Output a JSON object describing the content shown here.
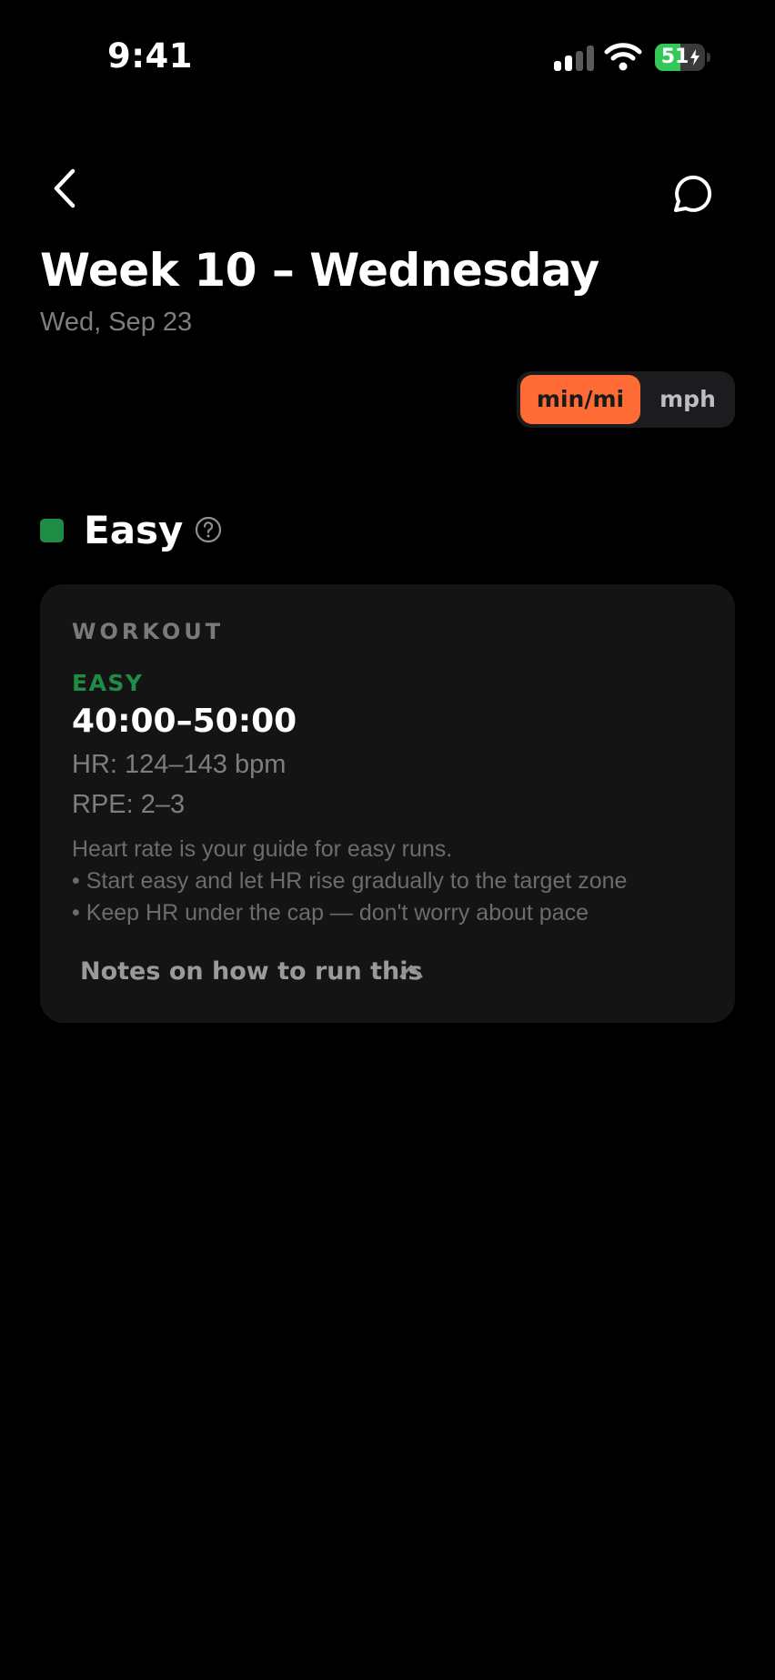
{
  "status_bar": {
    "time": "9:41",
    "battery_level": "51",
    "battery_fraction": 0.51,
    "icons": [
      "cellular-signal-icon",
      "wifi-icon",
      "battery-charging-icon"
    ]
  },
  "header": {
    "back_icon": "chevron-left-icon",
    "chat_icon": "chat-bubble-icon",
    "title": "Week 10 – Wednesday",
    "date": "Wed, Sep 23"
  },
  "unit_toggle": {
    "options": [
      {
        "label": "min/mi",
        "selected": true
      },
      {
        "label": "mph",
        "selected": false
      }
    ]
  },
  "section": {
    "label": "Easy",
    "help_icon": "question-circle-icon"
  },
  "workout": {
    "section_label": "WORKOUT",
    "type": "EASY",
    "duration": "40:00–50:00",
    "hr": "HR: 124–143 bpm",
    "rpe": "RPE: 2–3",
    "notes": [
      "Heart rate is your guide for easy runs.",
      "• Start easy and let HR rise gradually to the target zone",
      "• Keep HR under the cap — don't worry about pace"
    ],
    "notes_toggle_label": "Notes on how to run this",
    "notes_toggle_icon": "chevron-up-icon"
  },
  "colors": {
    "background": "#000000",
    "card": "#141414",
    "accent_orange": "#ff6b35",
    "easy_green": "#1e8c45",
    "battery_green": "#34c759",
    "muted_text": "#7d7d82"
  }
}
